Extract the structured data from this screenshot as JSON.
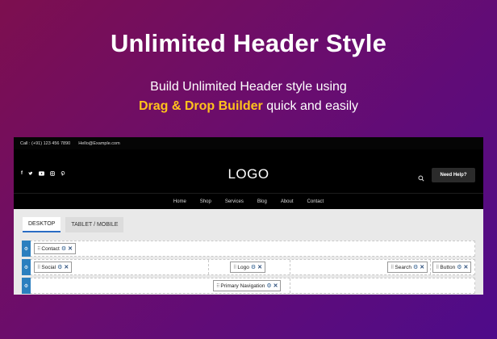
{
  "hero": {
    "title": "Unlimited Header Style",
    "line1": "Build Unlimited Header style using",
    "highlight": "Drag & Drop Builder",
    "line2_rest": " quick and easily"
  },
  "preview": {
    "topbar": {
      "phone": "Call : (+91) 123 456 7890",
      "email": "Hello@Example.com"
    },
    "socials": [
      "f",
      "t",
      "yt",
      "ig",
      "p"
    ],
    "logo": "LOGO",
    "help_button": "Need Help?",
    "nav": [
      "Home",
      "Shop",
      "Services",
      "Blog",
      "About",
      "Contact"
    ]
  },
  "builder": {
    "tabs": [
      "DESKTOP",
      "TABLET / MOBILE"
    ],
    "rows": [
      {
        "items": [
          "Contact"
        ]
      },
      {
        "items": [
          "Social",
          "Logo",
          "Search",
          "Button"
        ]
      },
      {
        "items": [
          "Primary Navigation"
        ]
      }
    ]
  },
  "colors": {
    "accent": "#ffc21c",
    "tab_active": "#2a6cc4",
    "row_handle": "#2b7fbf"
  }
}
